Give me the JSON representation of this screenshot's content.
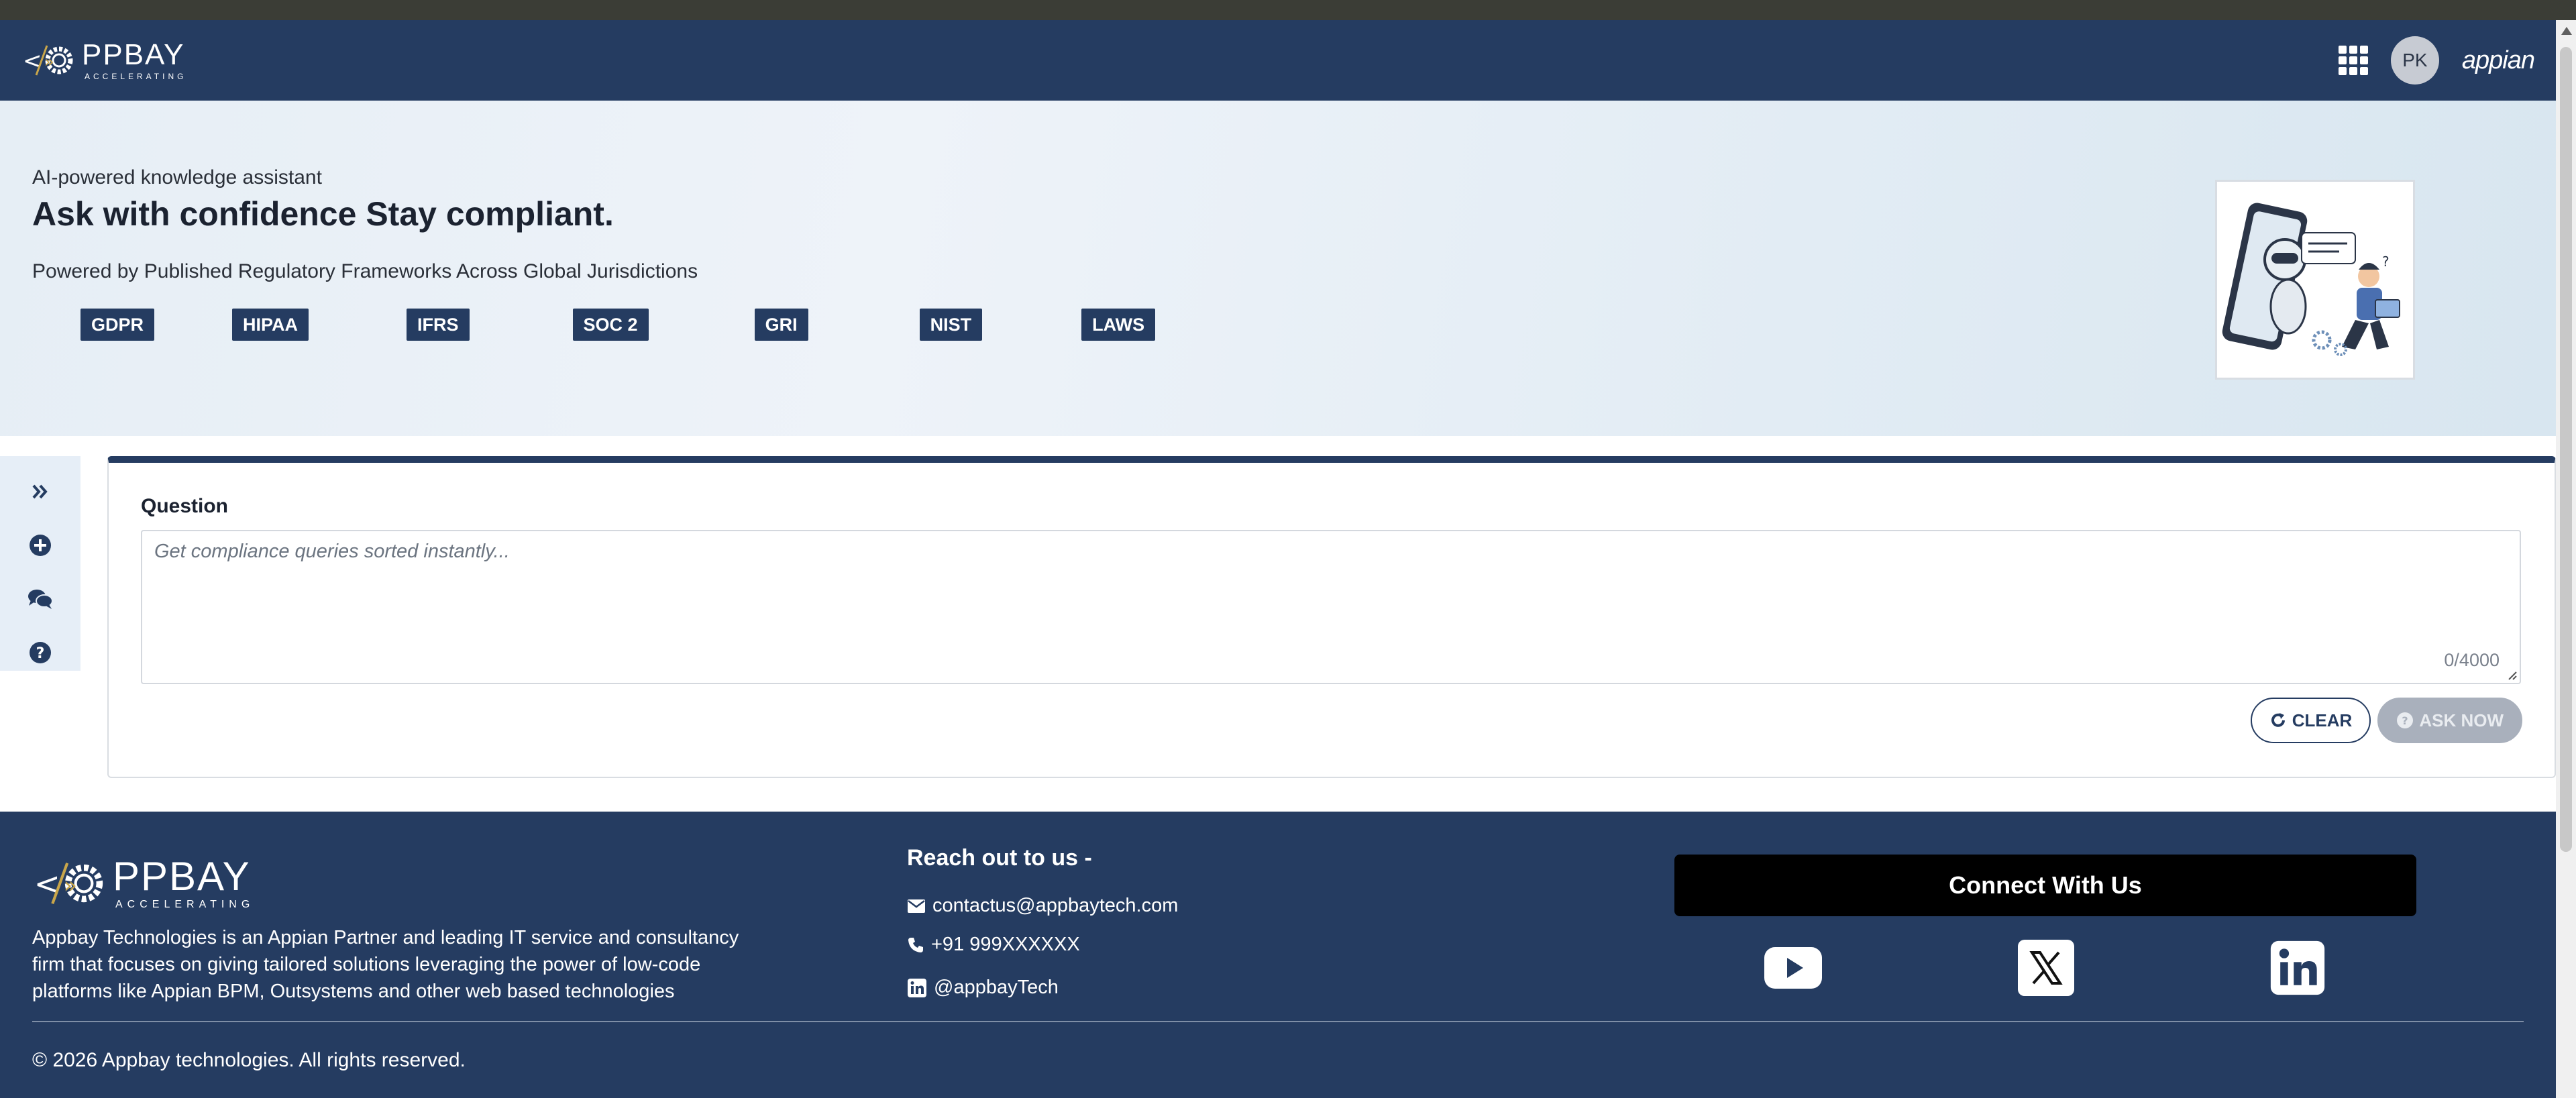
{
  "header": {
    "logo_text": "PPBAY",
    "logo_tagline": "ACCELERATING",
    "avatar_initials": "PK",
    "brand": "appian"
  },
  "hero": {
    "eyebrow": "AI-powered knowledge assistant",
    "title": "Ask with confidence Stay compliant.",
    "subtitle": "Powered by Published Regulatory Frameworks Across Global Jurisdictions",
    "tags": [
      "GDPR",
      "HIPAA",
      "IFRS",
      "SOC 2",
      "GRI",
      "NIST",
      "LAWS"
    ]
  },
  "side_toolbar": {
    "items": [
      "expand-icon",
      "add-circle-icon",
      "comments-icon",
      "help-icon"
    ]
  },
  "question": {
    "label": "Question",
    "placeholder": "Get compliance queries sorted instantly...",
    "counter": "0/4000",
    "clear_label": "CLEAR",
    "ask_label": "ASK NOW"
  },
  "footer": {
    "logo_text": "PPBAY",
    "logo_tagline": "ACCELERATING",
    "about": "Appbay Technologies is an Appian Partner and leading IT service and consultancy firm that focuses on giving tailored solutions leveraging the power of low-code platforms like Appian BPM, Outsystems and other web based technologies",
    "contact_title": "Reach out to us -",
    "email": "contactus@appbaytech.com",
    "phone": "+91 999XXXXXX",
    "linkedin_handle": "@appbayTech",
    "connect_title": "Connect With Us",
    "copyright": "© 2026 Appbay technologies. All rights reserved."
  },
  "colors": {
    "navy": "#253c61",
    "hero_bg": "#e6eef5",
    "disabled_button": "#a9b0bc",
    "gold": "#c9a64a"
  }
}
